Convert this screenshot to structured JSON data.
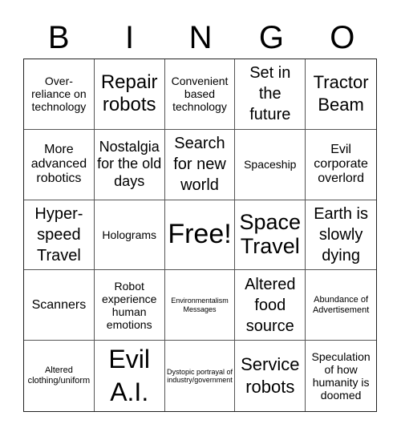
{
  "header": {
    "letters": [
      "B",
      "I",
      "N",
      "G",
      "O"
    ]
  },
  "cells": [
    "Over-reliance on technology",
    "Repair robots",
    "Convenient based technology",
    "Set in the future",
    "Tractor Beam",
    "More advanced robotics",
    "Nostalgia for the old days",
    "Search for new world",
    "Spaceship",
    "Evil corporate overlord",
    "Hyper-speed Travel",
    "Holograms",
    "Free!",
    "Space Travel",
    "Earth is slowly dying",
    "Scanners",
    "Robot experience human emotions",
    "Environmentalism Messages",
    "Altered food source",
    "Abundance of Advertisement",
    "Altered clothing/uniform",
    "Evil A.I.",
    "Dystopic portrayal of industry/government",
    "Service robots",
    "Speculation of how humanity is doomed"
  ]
}
